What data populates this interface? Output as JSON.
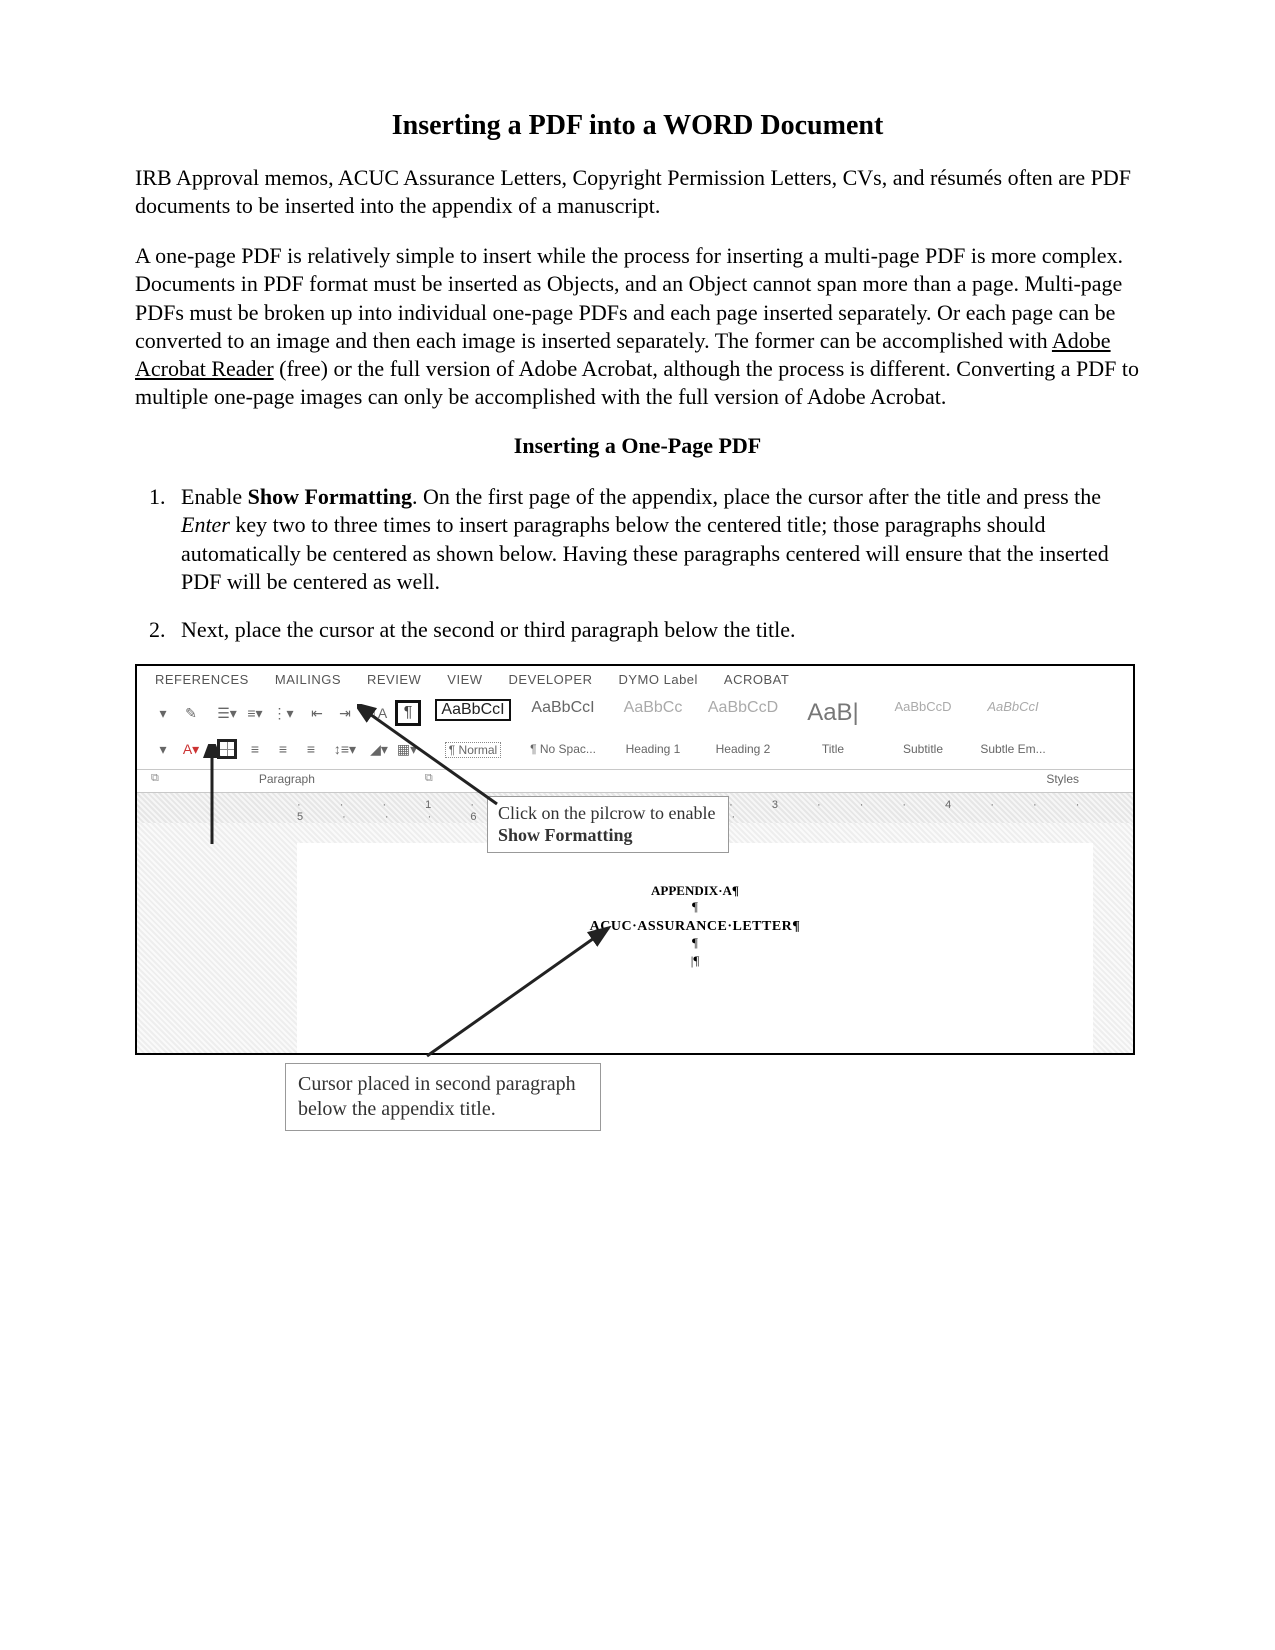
{
  "title": "Inserting a PDF into a WORD Document",
  "intro1": "IRB Approval memos, ACUC Assurance Letters, Copyright Permission Letters, CVs, and résumés often are PDF documents to be inserted into the appendix of a manuscript.",
  "intro2a": "A one-page PDF is relatively simple to insert while the process for inserting a multi-page PDF is more complex. Documents in PDF format must be inserted as Objects, and an Object cannot span more than a page. Multi-page PDFs must be broken up into individual one-page PDFs and each page inserted separately. Or each page can be converted to an image and then each image is inserted separately. The former can be accomplished with ",
  "intro2link": "Adobe Acrobat Reader",
  "intro2b": " (free) or the full version of Adobe Acrobat, although the process is different. Converting a PDF to multiple one-page images can only be accomplished with the full version of Adobe Acrobat.",
  "section1": "Inserting a One-Page PDF",
  "step1a": "Enable ",
  "step1bold": "Show Formatting",
  "step1b": ". On the first page of the appendix, place the cursor after the title and press the ",
  "step1italic": "Enter",
  "step1c": " key two to three times to insert paragraphs below the centered title; those paragraphs should automatically be centered as shown below. Having these paragraphs centered will ensure that the inserted PDF will be centered as well.",
  "step2": "Next, place the cursor at the second or third paragraph below the title.",
  "ribbon": {
    "tabs": [
      "REFERENCES",
      "MAILINGS",
      "REVIEW",
      "VIEW",
      "DEVELOPER",
      "DYMO Label",
      "ACROBAT"
    ],
    "styles": [
      {
        "preview": "AaBbCcI",
        "label": "¶ Normal",
        "bordered": true,
        "labelBordered": true
      },
      {
        "preview": "AaBbCcI",
        "label": "¶ No Spac..."
      },
      {
        "preview": "AaBbCc",
        "label": "Heading 1"
      },
      {
        "preview": "AaBbCcD",
        "label": "Heading 2"
      },
      {
        "preview": "AaB|",
        "label": "Title",
        "big": true
      },
      {
        "preview": "AaBbCcD",
        "label": "Subtitle"
      },
      {
        "preview": "AaBbCcI",
        "label": "Subtle Em...",
        "italic": true
      }
    ],
    "groupParagraph": "Paragraph",
    "groupStyles": "Styles"
  },
  "callout1a": "Click on the pilcrow to enable ",
  "callout1bold": "Show Formatting",
  "docText": {
    "appendix": "APPENDIX·A¶",
    "subtitle": "ACUC·ASSURANCE·LETTER¶"
  },
  "callout2": "Cursor placed in second paragraph below the appendix title."
}
